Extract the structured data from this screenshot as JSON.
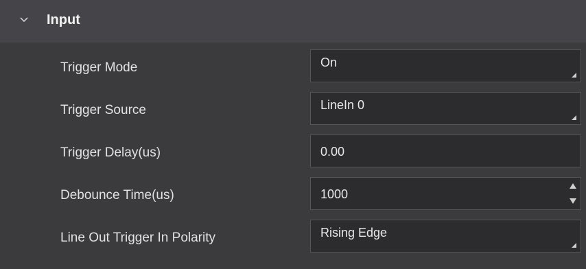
{
  "section": {
    "title": "Input",
    "expanded_icon": "chevron-down-icon"
  },
  "rows": [
    {
      "label": "Trigger Mode",
      "value": "On",
      "control": "combo"
    },
    {
      "label": "Trigger Source",
      "value": "LineIn 0",
      "control": "combo"
    },
    {
      "label": "Trigger Delay(us)",
      "value": "0.00",
      "control": "text"
    },
    {
      "label": "Debounce Time(us)",
      "value": "1000",
      "control": "spin"
    },
    {
      "label": "Line Out Trigger In Polarity",
      "value": "Rising Edge",
      "control": "combo"
    }
  ],
  "colors": {
    "background": "#3b3b3e",
    "header": "#454549",
    "field": "#2c2c2f",
    "text": "#e6e6e6"
  }
}
